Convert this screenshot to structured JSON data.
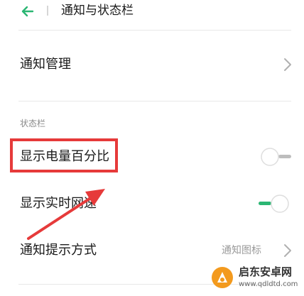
{
  "header": {
    "title": "通知与状态栏",
    "back_icon": "arrow-left-icon"
  },
  "rows": {
    "notification_management": {
      "label": "通知管理"
    },
    "battery_percentage": {
      "label": "显示电量百分比",
      "toggle_on": false
    },
    "realtime_speed": {
      "label": "显示实时网速",
      "toggle_on": true
    },
    "notification_style": {
      "label": "通知提示方式",
      "value": "通知图标"
    }
  },
  "section": {
    "status_bar_label": "状态栏"
  },
  "colors": {
    "accent": "#2bb673",
    "highlight": "#e63a3a",
    "toggle_off": "#bdbdbd"
  },
  "watermark": {
    "name": "启东安卓网",
    "url": "www.qdldtd.com"
  }
}
